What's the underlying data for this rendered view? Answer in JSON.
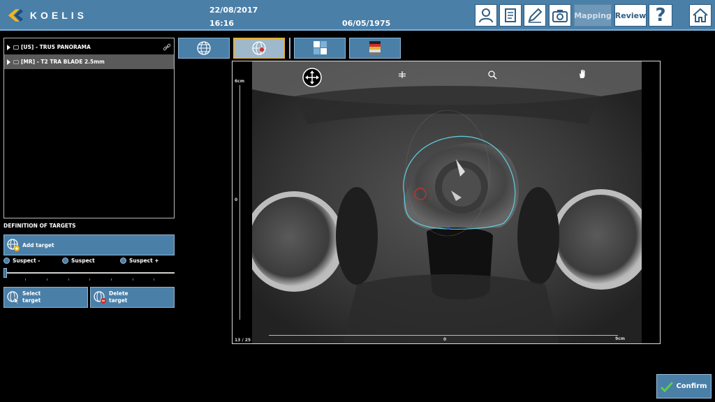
{
  "header": {
    "brand": "KOELIS",
    "date": "22/08/2017",
    "time": "16:16",
    "birth_date": "06/05/1975",
    "mapping_label": "Mapping",
    "review_label": "Review",
    "question_label": "?"
  },
  "series": [
    {
      "label": "[US] - TRUS PANORAMA",
      "selected": false
    },
    {
      "label": "[MR] - T2 TRA BLADE 2.5mm",
      "selected": true
    }
  ],
  "targets": {
    "title": "DEFINITION OF TARGETS",
    "add_label": "Add target",
    "radios": [
      "Suspect -",
      "Suspect",
      "Suspect +"
    ],
    "select_label_1": "Select",
    "select_label_2": "target",
    "delete_label_1": "Delete",
    "delete_label_2": "target",
    "slider_value": 0
  },
  "viewer": {
    "scale_top": "6cm",
    "scale_mid": "0",
    "scale_bottom_mid": "0",
    "scale_right": "9cm",
    "slice": "13 / 25"
  },
  "confirm_label": "Confirm",
  "colors": {
    "accent": "#4a7fa8",
    "active_border": "#e3b23c",
    "contour": "#5ec8d8",
    "target": "#d0302a"
  }
}
